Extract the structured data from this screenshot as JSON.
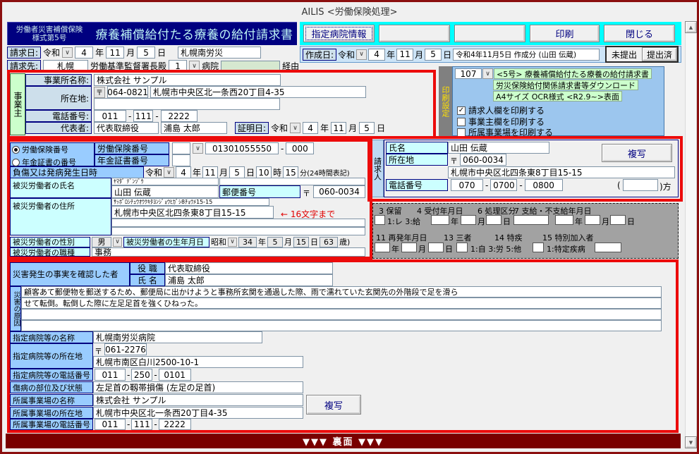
{
  "glyphs": {
    "dropdown": "∨",
    "postal_mark": "〒",
    "check": "✓",
    "scroll_up": "▲",
    "scroll_down": "▼",
    "dash": "-",
    "careof_open": "(",
    "careof_close": ")方"
  },
  "units": {
    "year": "年",
    "month": "11月",
    "month_u": "月",
    "day": "日",
    "hour": "時",
    "minute_suffix": "分(24時間表記)"
  },
  "window": {
    "title": "AILIS <労働保険処理>",
    "back_bar_label": "▼▼▼ 裏面 ▼▼▼"
  },
  "header": {
    "insurance_label": "労働者災害補償保険",
    "form_number": "様式第5号",
    "form_title": "療養補償給付たる療養の給付請求書",
    "hospital_info_button": "指定病院情報",
    "blank_button_1": "",
    "blank_button_2": "",
    "print_button": "印刷",
    "close_button": "閉じる"
  },
  "claim_date": {
    "label": "請求日:",
    "era": "令和",
    "year": "4",
    "month": "11",
    "day": "5",
    "office": "札幌南労災"
  },
  "claim_to": {
    "label": "請求先:",
    "office": "札幌",
    "office_suffix": "労働基準監督署長殿",
    "route_no": "1",
    "route_type": "病院",
    "via_value": "",
    "via": "経由"
  },
  "created": {
    "label": "作成日:",
    "era": "令和",
    "year": "4",
    "month": "11",
    "day": "5",
    "note": "令和4年11月5日 作成分 (山田 伝蔵)",
    "unsubmitted": "未提出",
    "submitted": "提出済"
  },
  "employer": {
    "vertical_label": "事業主",
    "name_label": "事業所名称:",
    "name": "株式会社 サンプル",
    "addr_label": "所在地:",
    "postal_code": "064-0821",
    "addr": "札幌市中央区北一条西20丁目4-35",
    "addr2": "",
    "phone_label": "電話番号:",
    "phone1": "011",
    "phone2": "111",
    "phone3": "2222",
    "rep_label": "代表者:",
    "rep_title": "代表取締役",
    "rep_name": "浦島 太郎",
    "cert_label": "証明日:",
    "era": "令和",
    "year": "4",
    "month": "11",
    "day": "5"
  },
  "print_settings": {
    "vertical_label": "印刷設定",
    "form_code": "107",
    "doc_line1": "<5号> 療養補償給付たる療養の給付請求書",
    "doc_line2": "労災保険給付関係請求書等ダウンロード",
    "doc_line3": "A4サイズ OCR様式 <R2.9~>表面",
    "cb_claimant": "請求人欄を印刷する",
    "cb_employer": "事業主欄を印刷する",
    "cb_workplace": "所属事業場を印刷する"
  },
  "insurance": {
    "radio_rodo": "労働保険番号",
    "radio_nenkin": "年金証書の番号",
    "rodo_label": "労働保険番号",
    "nenkin_label": "年金証書番号",
    "combo_value": "",
    "number": "01301055550",
    "branch": "000",
    "nenkin_value": "",
    "injury_label": "負傷又は発病発生日時",
    "era": "令和",
    "year": "4",
    "month": "11",
    "day": "5",
    "hour": "10",
    "minute": "15"
  },
  "victim": {
    "name_label": "被災労働者の氏名",
    "name_kana": "ﾔﾏﾀﾞ ﾃﾞﾝｿﾞｳ",
    "name": "山田 伝蔵",
    "postal_label": "郵便番号",
    "postal_code": "060-0034",
    "addr_label": "被災労働者の住所",
    "addr_kana": "ｻｯﾎﾟﾛｼﾁｭｳｵｳｸｷﾀﾖﾝｼﾞｮｳﾋｶﾞｼ8ﾁｮｳﾒ15-15",
    "addr": "札幌市中央区北四条東8丁目15-15",
    "addr_note": "← 16文字まで",
    "addr_extra1": "",
    "addr_extra2": "",
    "sex_label": "被災労働者の性別",
    "sex": "男",
    "birth_label": "被災労働者の生年月日",
    "birth_era": "昭和",
    "birth_year": "34",
    "birth_month": "5",
    "birth_day": "15",
    "age": "63",
    "age_suffix": "歳)",
    "job_label": "被災労働者の職種",
    "job": "事務"
  },
  "claimant": {
    "vertical_label": "請求人",
    "name_label": "氏名",
    "name": "山田 伝蔵",
    "copy_button": "複写",
    "addr_label": "所在地",
    "postal_code": "060-0034",
    "addr": "札幌市中央区北四条東8丁目15-15",
    "phone_label": "電話番号",
    "phone1": "070",
    "phone2": "0700",
    "phone3": "0800",
    "careof_value": ""
  },
  "ocr": {
    "f3": "3 保留",
    "f3_opts": "1:レ 3:給",
    "f4": "4 受付年月日",
    "f6": "6 処理区分",
    "f7": "7 支給・不支給年月日",
    "f11": "11 再発年月日",
    "f13": "13 三者",
    "f13_opts": "1:自 3:労 5:他",
    "f14": "14 特疾",
    "f14_opts": "1:特定疾病",
    "f15": "15 特別加入者"
  },
  "accident": {
    "witness_label": "災害発生の事実を確認した者",
    "role_label": "役 職",
    "role": "代表取締役",
    "name_label": "氏 名",
    "name": "浦島 太郎",
    "cause_label": "災害の原因",
    "line1": "顧客あて郵便物を郵送するため、郵便局に出かけようと事務所玄関を通過した際、雨で濡れていた玄関先の外階段で足を滑ら",
    "line2": "せて転倒。転倒した際に左足足首を強くひねった。",
    "line3": "",
    "line4": ""
  },
  "hospital": {
    "name_label": "指定病院等の名称",
    "name": "札幌南労災病院",
    "addr_label": "指定病院等の所在地",
    "postal_code": "061-2276",
    "addr": "札幌市南区白川2500-10-1",
    "phone_label": "指定病院等の電話番号",
    "phone1": "011",
    "phone2": "250",
    "phone3": "0101",
    "injury_label": "傷病の部位及び状態",
    "injury": "左足首の靱帯損傷 (左足の足首)"
  },
  "workplace": {
    "name_label": "所属事業場の名称",
    "name": "株式会社 サンプル",
    "copy_button": "複写",
    "addr_label": "所属事業場の所在地",
    "addr": "札幌市中央区北一条西20丁目4-35",
    "phone_label": "所属事業場の電話番号",
    "phone1": "011",
    "phone2": "111",
    "phone3": "2222"
  },
  "colors": {
    "window_border": "#8b0f0f",
    "highlight_red": "#ec0b0b",
    "navy": "#000080",
    "toolbar_cyan": "#00ffff",
    "label_blue": "#99ccff",
    "label_pale_cyan": "#ccffff",
    "label_pale_blue": "#cddfeb",
    "green": "#ccffcc",
    "panel_blue": "#9cc6ee",
    "gray_panel": "#a2a2a2",
    "back_bar": "#790000"
  }
}
